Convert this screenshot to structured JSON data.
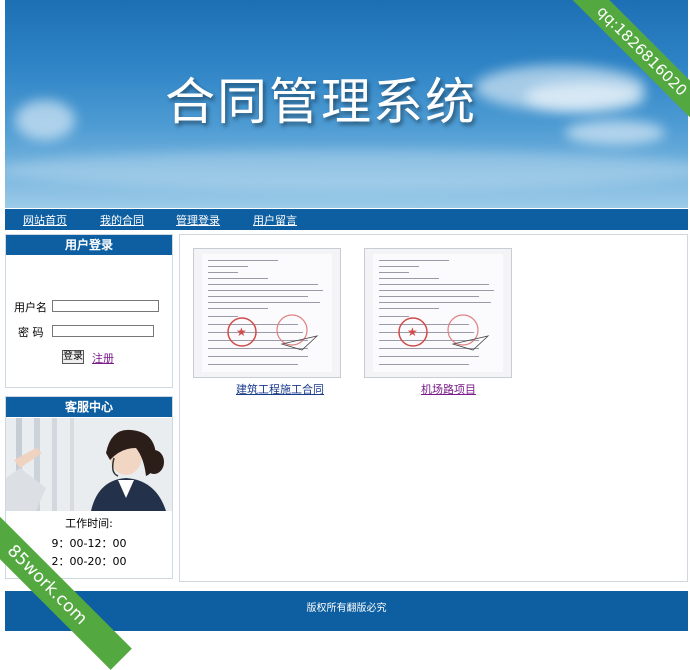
{
  "banner": {
    "title": "合同管理系统"
  },
  "nav": {
    "items": [
      {
        "label": "网站首页"
      },
      {
        "label": "我的合同"
      },
      {
        "label": "管理登录"
      },
      {
        "label": "用户留言"
      }
    ]
  },
  "login": {
    "title": "用户登录",
    "username_label": "用户名",
    "password_label": "密 码",
    "username_value": "",
    "password_value": "",
    "submit_label": "登录",
    "register_label": "注册"
  },
  "service": {
    "title": "客服中心",
    "hours_label": "工作时间:",
    "hours_morning": "9：00-12：00",
    "hours_afternoon": "2：00-20：00"
  },
  "contracts": [
    {
      "title": "建筑工程施工合同",
      "color": "#1a3a8a"
    },
    {
      "title": "机场路项目",
      "color": "#7b1a8a"
    }
  ],
  "footer": {
    "text": "版权所有翻版必究"
  },
  "watermarks": {
    "top_right": "qq:1826816020",
    "bottom_left": "85work.com"
  },
  "colors": {
    "nav": "#0e5fa1",
    "ribbon": "#53a93f"
  }
}
